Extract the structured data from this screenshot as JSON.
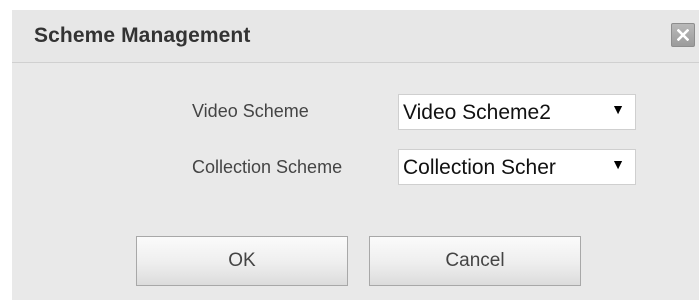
{
  "dialog": {
    "title": "Scheme Management",
    "close_icon": "close-icon"
  },
  "form": {
    "video_scheme": {
      "label": "Video Scheme",
      "value": "Video Scheme2"
    },
    "collection_scheme": {
      "label": "Collection Scheme",
      "value": "Collection Scher"
    },
    "dropdown_icon": "chevron-down-icon"
  },
  "buttons": {
    "ok_label": "OK",
    "cancel_label": "Cancel"
  },
  "colors": {
    "dialog_bg": "#e9e9e9",
    "close_button": "#a9a9a9",
    "select_bg": "#ffffff"
  }
}
